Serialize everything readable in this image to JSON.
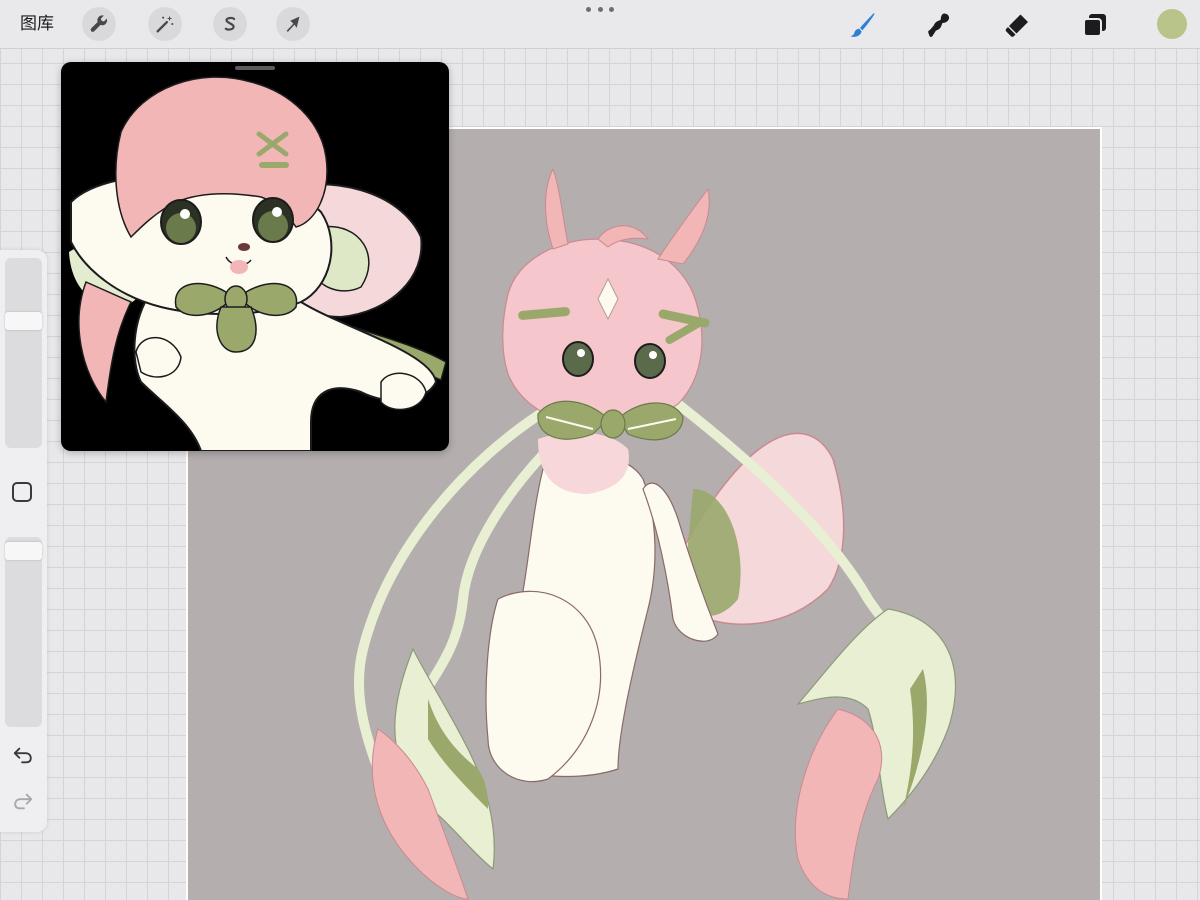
{
  "toolbar": {
    "gallery_label": "图库",
    "left_tools": [
      {
        "name": "actions",
        "icon": "wrench-icon"
      },
      {
        "name": "adjustments",
        "icon": "magic-wand-icon"
      },
      {
        "name": "selection",
        "icon": "selection-s-icon"
      },
      {
        "name": "transform",
        "icon": "arrow-cursor-icon"
      }
    ],
    "right_tools": [
      {
        "name": "brush",
        "icon": "brush-icon",
        "active": true
      },
      {
        "name": "smudge",
        "icon": "smudge-icon",
        "active": false
      },
      {
        "name": "eraser",
        "icon": "eraser-icon",
        "active": false
      },
      {
        "name": "layers",
        "icon": "layers-icon",
        "active": false
      }
    ],
    "current_color": "#b8c48a"
  },
  "sidebar": {
    "brush_size_level": 0.3,
    "opacity_level": 0.02
  },
  "colors": {
    "accent": "#2f7fd6",
    "canvas_bg": "#b5aeae",
    "reference_bg": "#000000",
    "pink": "#f2b6b6",
    "sage_green": "#9aa86b",
    "cream": "#fdfbf0"
  }
}
